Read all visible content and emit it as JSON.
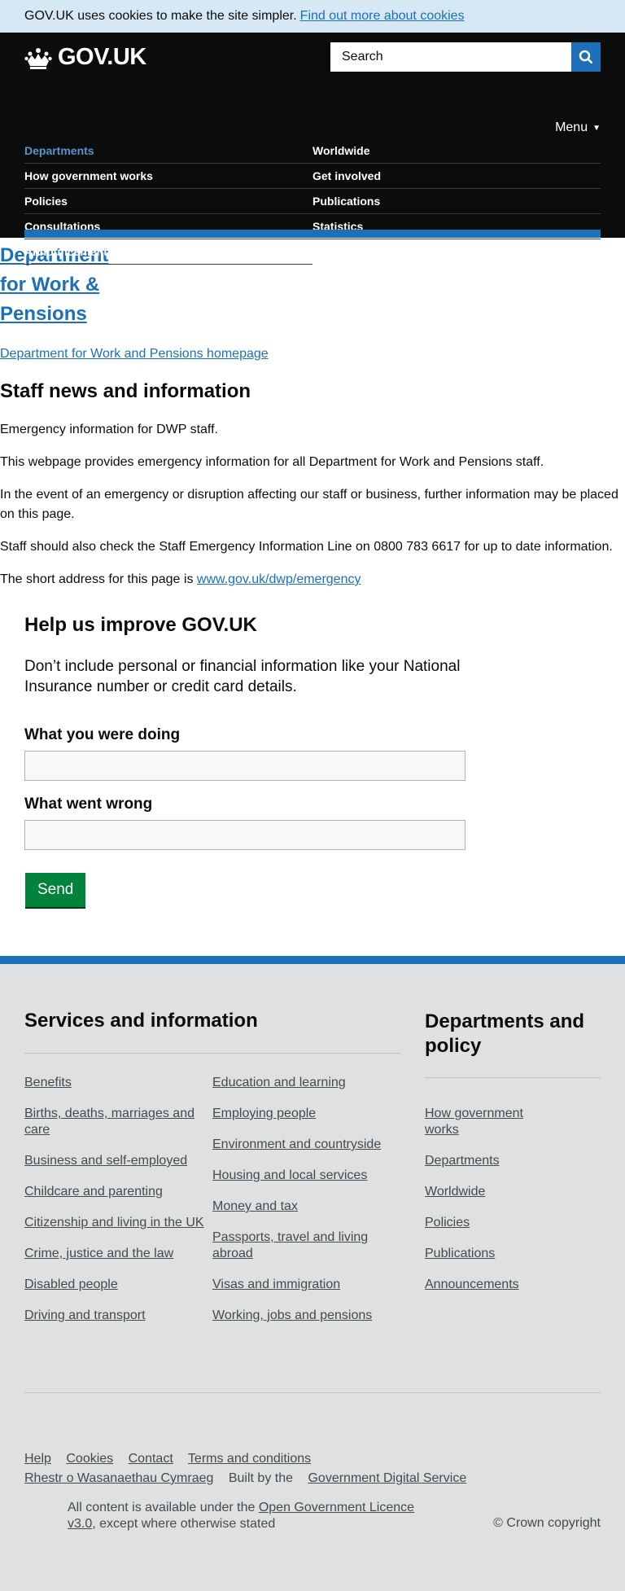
{
  "cookie_banner": {
    "text": "GOV.UK uses cookies to make the site simpler.",
    "link": "Find out more about cookies"
  },
  "header": {
    "logo": "GOV.UK",
    "search_placeholder": "Search",
    "menu_label": "Menu",
    "nav_left": [
      "Departments",
      "How government works",
      "Policies",
      "Consultations",
      "Announcements"
    ],
    "nav_right": [
      "Worldwide",
      "Get involved",
      "Publications",
      "Statistics"
    ]
  },
  "org": {
    "title": "Department for Work & Pensions",
    "homepage_link": "Department for Work and Pensions homepage"
  },
  "page": {
    "title": "Staff news and information",
    "p1": "Emergency information for DWP staff.",
    "p2": "This webpage provides emergency information for all Department for Work and Pensions staff.",
    "p3": "In the event of an emergency or disruption affecting our staff or business, further information may be placed on this page.",
    "p4": "Staff should also check the Staff Emergency Information Line on 0800 783 6617 for up to date information.",
    "p5_text": "The short address for this page is",
    "p5_link": "www.gov.uk/dwp/emergency"
  },
  "feedback": {
    "title": "Help us improve GOV.UK",
    "intro": "Don’t include personal or financial information like your National Insurance number or credit card details.",
    "label_doing": "What you were doing",
    "label_wrong": "What went wrong",
    "send": "Send"
  },
  "footer": {
    "services_title": "Services and information",
    "services_col1": [
      "Benefits",
      "Births, deaths, marriages and care",
      "Business and self-employed",
      "Childcare and parenting",
      "Citizenship and living in the UK",
      "Crime, justice and the law",
      "Disabled people",
      "Driving and transport"
    ],
    "services_col2": [
      "Education and learning",
      "Employing people",
      "Environment and countryside",
      "Housing and local services",
      "Money and tax",
      "Passports, travel and living abroad",
      "Visas and immigration",
      "Working, jobs and pensions"
    ],
    "dept_title": "Departments and policy",
    "dept_links": [
      "How government works",
      "Departments",
      "Worldwide",
      "Policies",
      "Publications",
      "Announcements"
    ],
    "meta_links": [
      "Help",
      "Cookies",
      "Contact",
      "Terms and conditions"
    ],
    "welsh": "Rhestr o Wasanaethau Cymraeg",
    "built_by": "Built by the",
    "built_by_link": "Government Digital Service",
    "licence_pre": "All content is available under the",
    "licence_link": "Open Government Licence v3.0",
    "licence_post": ", except where otherwise stated",
    "crown": "© Crown copyright"
  },
  "colors": {
    "brand_blue": "#1d70b8",
    "header_black": "#0b0c0c",
    "button_green": "#00823b",
    "footer_grey": "#dee0e2"
  }
}
